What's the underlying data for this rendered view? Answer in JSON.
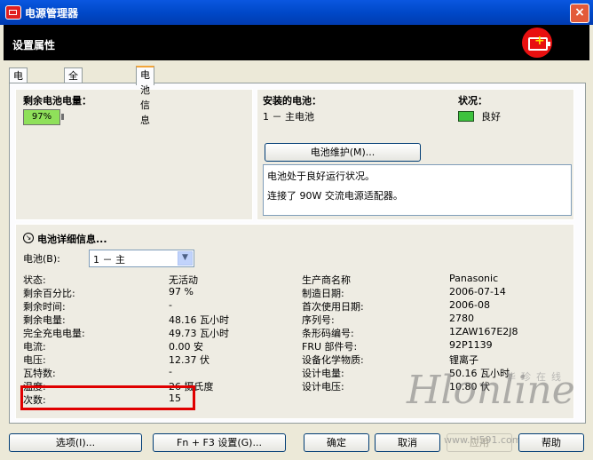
{
  "window": {
    "title": "电源管理器",
    "close_symbol": "×"
  },
  "header": {
    "title": "设置属性"
  },
  "tabs": [
    "电源方案",
    "全局电源设置",
    "电池信息"
  ],
  "left_box": {
    "title": "剩余电池电量：",
    "percent": "97%"
  },
  "installed": {
    "title": "安装的电池：",
    "item": "1 － 主电池"
  },
  "status": {
    "title": "状况：",
    "value": "良好"
  },
  "maintenance_button": "电池维护(M)...",
  "info_lines": [
    "电池处于良好运行状况。",
    "连接了 90W 交流电源适配器。"
  ],
  "details": {
    "title": "电池详细信息...",
    "battery_label": "电池(B):",
    "battery_selected": "1 － 主",
    "left_rows": [
      {
        "label": "状态:",
        "value": "无活动"
      },
      {
        "label": "剩余百分比:",
        "value": "97 %"
      },
      {
        "label": "剩余时间:",
        "value": "-"
      },
      {
        "label": "剩余电量:",
        "value": "48.16 瓦小时"
      },
      {
        "label": "完全充电电量:",
        "value": "49.73 瓦小时"
      },
      {
        "label": "电流:",
        "value": "0.00 安"
      },
      {
        "label": "电压:",
        "value": "12.37 伏"
      },
      {
        "label": "瓦特数:",
        "value": "-"
      },
      {
        "label": "温度:",
        "value": "26 摄氏度"
      },
      {
        "label": "次数:",
        "value": "15"
      }
    ],
    "right_rows": [
      {
        "label": "生产商名称",
        "value": "Panasonic"
      },
      {
        "label": "制造日期:",
        "value": "2006-07-14"
      },
      {
        "label": "首次使用日期:",
        "value": "2006-08"
      },
      {
        "label": "序列号:",
        "value": "2780"
      },
      {
        "label": "条形码编号:",
        "value": "1ZAW167E2J8"
      },
      {
        "label": "FRU 部件号:",
        "value": "92P1139"
      },
      {
        "label": "设备化学物质:",
        "value": "锂离子"
      },
      {
        "label": "设计电量:",
        "value": "50.16 瓦小时"
      },
      {
        "label": "设计电压:",
        "value": "10.80 伏"
      }
    ]
  },
  "buttons": {
    "options": "选项(I)...",
    "fn_f3": "Fn + F3 设置(G)...",
    "ok": "确定",
    "cancel": "取消",
    "apply": "应用",
    "help": "帮助"
  },
  "watermark": {
    "logo": "Hlonline",
    "cn": "华珍在线",
    "url": "www.hl591.com"
  }
}
